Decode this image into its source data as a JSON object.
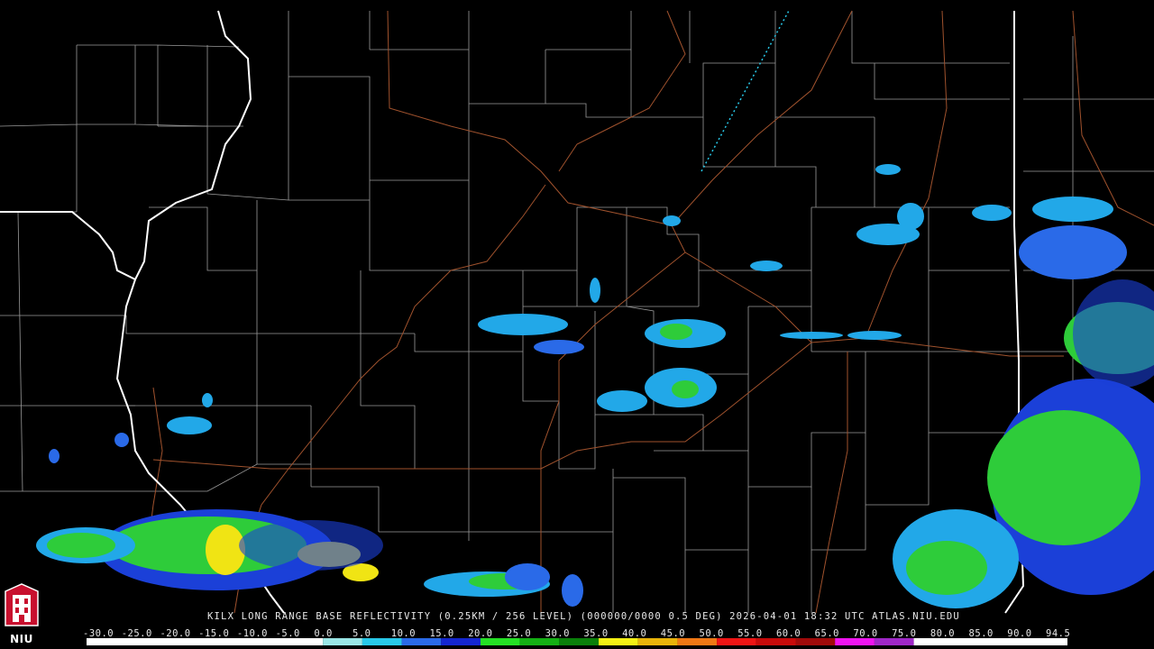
{
  "map": {
    "title": "KILX LONG RANGE BASE REFLECTIVITY (0.25KM / 256 LEVEL) (000000/0000 0.5 DEG) 2026-04-01 18:32 UTC  ATLAS.NIU.EDU",
    "site_logo_text": "NIU",
    "colors": {
      "background": "#000000",
      "county_line": "#9a9a9a",
      "road": "#a0522d",
      "state_line": "#ffffff",
      "caption_text": "#e8e8e8"
    }
  },
  "legend": {
    "labels": [
      "-30.0",
      "-25.0",
      "-20.0",
      "-15.0",
      "-10.0",
      "-5.0",
      "0.0",
      "5.0",
      "10.0",
      "15.0",
      "20.0",
      "25.0",
      "30.0",
      "35.0",
      "40.0",
      "45.0",
      "50.0",
      "55.0",
      "60.0",
      "65.0",
      "70.0",
      "75.0",
      "80.0",
      "85.0",
      "90.0",
      "94.5"
    ],
    "min": -30,
    "max": 94.5,
    "colorbar": [
      {
        "from": -30,
        "to": 0,
        "color": "#ffffff"
      },
      {
        "from": 0,
        "to": 5,
        "color": "#9ae6e6"
      },
      {
        "from": 5,
        "to": 10,
        "color": "#28c8e8"
      },
      {
        "from": 10,
        "to": 15,
        "color": "#2a6ae8"
      },
      {
        "from": 15,
        "to": 20,
        "color": "#1426d0"
      },
      {
        "from": 20,
        "to": 25,
        "color": "#24e024"
      },
      {
        "from": 25,
        "to": 30,
        "color": "#14b014"
      },
      {
        "from": 30,
        "to": 35,
        "color": "#0a800a"
      },
      {
        "from": 35,
        "to": 40,
        "color": "#f4f014"
      },
      {
        "from": 40,
        "to": 45,
        "color": "#e8b40a"
      },
      {
        "from": 45,
        "to": 50,
        "color": "#f07814"
      },
      {
        "from": 50,
        "to": 55,
        "color": "#f01414"
      },
      {
        "from": 55,
        "to": 60,
        "color": "#c80a0a"
      },
      {
        "from": 60,
        "to": 65,
        "color": "#a00a0a"
      },
      {
        "from": 65,
        "to": 70,
        "color": "#f014f0"
      },
      {
        "from": 70,
        "to": 75,
        "color": "#a028c8"
      },
      {
        "from": 75,
        "to": 94.5,
        "color": "#ffffff"
      }
    ]
  }
}
